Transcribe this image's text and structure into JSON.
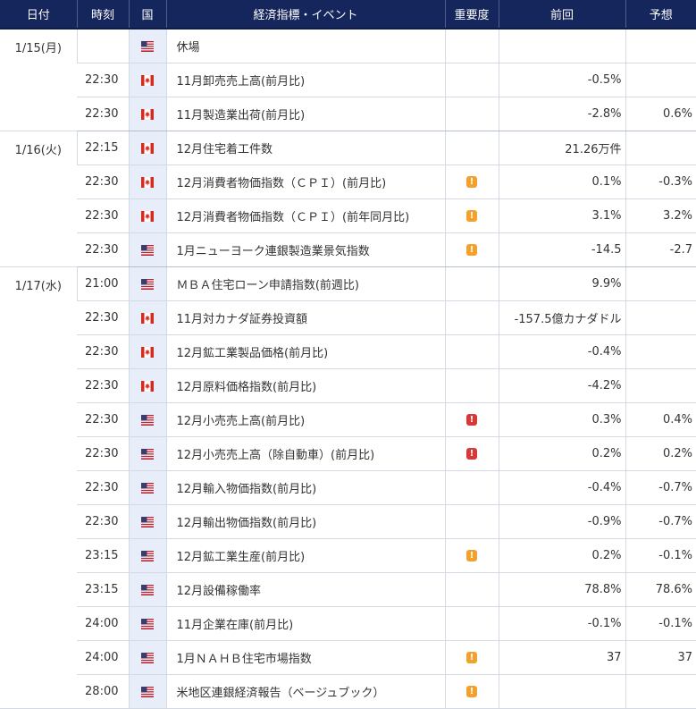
{
  "colors": {
    "header_bg": "#14265b",
    "importance_medium": "#f4a12b",
    "importance_high": "#d83838"
  },
  "header": {
    "date": "日付",
    "time": "時刻",
    "country": "国",
    "event": "経済指標・イベント",
    "importance": "重要度",
    "previous": "前回",
    "forecast": "予想"
  },
  "rows": [
    {
      "date": "1/15(月)",
      "time": "",
      "country": "us-flag-icon",
      "event": "休場",
      "importance": "",
      "previous": "",
      "forecast": ""
    },
    {
      "date": "",
      "time": "22:30",
      "country": "ca-flag-icon",
      "event": "11月卸売売上高(前月比)",
      "importance": "",
      "previous": "-0.5%",
      "forecast": ""
    },
    {
      "date": "",
      "time": "22:30",
      "country": "ca-flag-icon",
      "event": "11月製造業出荷(前月比)",
      "importance": "",
      "previous": "-2.8%",
      "forecast": "0.6%"
    },
    {
      "date": "1/16(火)",
      "time": "22:15",
      "country": "ca-flag-icon",
      "event": "12月住宅着工件数",
      "importance": "",
      "previous": "21.26万件",
      "forecast": ""
    },
    {
      "date": "",
      "time": "22:30",
      "country": "ca-flag-icon",
      "event": "12月消費者物価指数（ＣＰＩ）(前月比)",
      "importance": "medium",
      "previous": "0.1%",
      "forecast": "-0.3%"
    },
    {
      "date": "",
      "time": "22:30",
      "country": "ca-flag-icon",
      "event": "12月消費者物価指数（ＣＰＩ）(前年同月比)",
      "importance": "medium",
      "previous": "3.1%",
      "forecast": "3.2%"
    },
    {
      "date": "",
      "time": "22:30",
      "country": "us-flag-icon",
      "event": "1月ニューヨーク連銀製造業景気指数",
      "importance": "medium",
      "previous": "-14.5",
      "forecast": "-2.7"
    },
    {
      "date": "1/17(水)",
      "time": "21:00",
      "country": "us-flag-icon",
      "event": "ＭＢＡ住宅ローン申請指数(前週比)",
      "importance": "",
      "previous": "9.9%",
      "forecast": ""
    },
    {
      "date": "",
      "time": "22:30",
      "country": "ca-flag-icon",
      "event": "11月対カナダ証券投資額",
      "importance": "",
      "previous": "-157.5億カナダドル",
      "forecast": ""
    },
    {
      "date": "",
      "time": "22:30",
      "country": "ca-flag-icon",
      "event": "12月鉱工業製品価格(前月比)",
      "importance": "",
      "previous": "-0.4%",
      "forecast": ""
    },
    {
      "date": "",
      "time": "22:30",
      "country": "ca-flag-icon",
      "event": "12月原料価格指数(前月比)",
      "importance": "",
      "previous": "-4.2%",
      "forecast": ""
    },
    {
      "date": "",
      "time": "22:30",
      "country": "us-flag-icon",
      "event": "12月小売売上高(前月比)",
      "importance": "high",
      "previous": "0.3%",
      "forecast": "0.4%"
    },
    {
      "date": "",
      "time": "22:30",
      "country": "us-flag-icon",
      "event": "12月小売売上高（除自動車）(前月比)",
      "importance": "high",
      "previous": "0.2%",
      "forecast": "0.2%"
    },
    {
      "date": "",
      "time": "22:30",
      "country": "us-flag-icon",
      "event": "12月輸入物価指数(前月比)",
      "importance": "",
      "previous": "-0.4%",
      "forecast": "-0.7%"
    },
    {
      "date": "",
      "time": "22:30",
      "country": "us-flag-icon",
      "event": "12月輸出物価指数(前月比)",
      "importance": "",
      "previous": "-0.9%",
      "forecast": "-0.7%"
    },
    {
      "date": "",
      "time": "23:15",
      "country": "us-flag-icon",
      "event": "12月鉱工業生産(前月比)",
      "importance": "medium",
      "previous": "0.2%",
      "forecast": "-0.1%"
    },
    {
      "date": "",
      "time": "23:15",
      "country": "us-flag-icon",
      "event": "12月設備稼働率",
      "importance": "",
      "previous": "78.8%",
      "forecast": "78.6%"
    },
    {
      "date": "",
      "time": "24:00",
      "country": "us-flag-icon",
      "event": "11月企業在庫(前月比)",
      "importance": "",
      "previous": "-0.1%",
      "forecast": "-0.1%"
    },
    {
      "date": "",
      "time": "24:00",
      "country": "us-flag-icon",
      "event": "1月ＮＡＨＢ住宅市場指数",
      "importance": "medium",
      "previous": "37",
      "forecast": "37"
    },
    {
      "date": "",
      "time": "28:00",
      "country": "us-flag-icon",
      "event": "米地区連銀経済報告（ベージュブック）",
      "importance": "medium",
      "previous": "",
      "forecast": ""
    }
  ]
}
